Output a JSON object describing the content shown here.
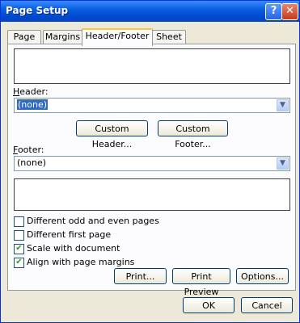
{
  "window": {
    "title": "Page Setup"
  },
  "titlebar": {
    "help_label": "?",
    "close_label": "✕"
  },
  "tabs": [
    {
      "label": "Page"
    },
    {
      "label": "Margins"
    },
    {
      "label": "Header/Footer"
    },
    {
      "label": "Sheet"
    }
  ],
  "header": {
    "label": "Header:",
    "value": "(none)"
  },
  "footer": {
    "label": "Footer:",
    "value": "(none)"
  },
  "buttons": {
    "custom_header": "Custom Header...",
    "custom_footer": "Custom Footer...",
    "print": "Print...",
    "print_preview": "Print Preview",
    "options": "Options...",
    "ok": "OK",
    "cancel": "Cancel"
  },
  "options": [
    {
      "label": "Different odd and even pages",
      "checked": false
    },
    {
      "label": "Different first page",
      "checked": false
    },
    {
      "label": "Scale with document",
      "checked": true
    },
    {
      "label": "Align with page margins",
      "checked": true
    }
  ]
}
